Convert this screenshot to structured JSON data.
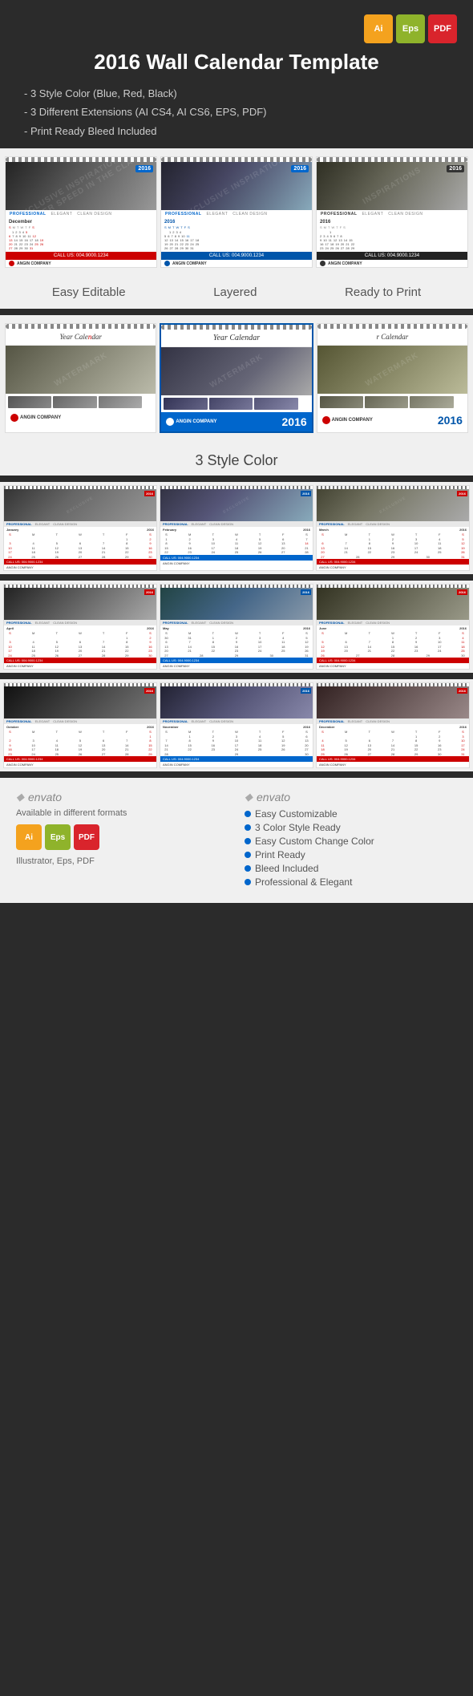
{
  "header": {
    "title": "2016 Wall Calendar Template",
    "badges": [
      "Ai",
      "Eps",
      "PDF"
    ],
    "features": [
      "3 Style Color (Blue, Red, Black)",
      "3 Different Extensions (AI CS4, AI CS6, EPS, PDF)",
      "Print Ready Bleed Included"
    ]
  },
  "features_row": {
    "items": [
      "Easy Editable",
      "Layered",
      "Ready to Print"
    ]
  },
  "section1": {
    "title": "3 Style Color"
  },
  "bottom": {
    "available_label": "Available in different formats",
    "envato_label": "envato",
    "format_label": "Illustrator, Eps, PDF",
    "features": [
      "Easy Customizable",
      "3 Color Style Ready",
      "Easy Custom Change Color",
      "Print Ready",
      "Bleed Included",
      "Professional & Elegant"
    ]
  },
  "months": {
    "row1": [
      "January",
      "February",
      "March"
    ],
    "row2": [
      "April",
      "May",
      "June"
    ],
    "row3": [
      "October",
      "November",
      "December"
    ]
  }
}
